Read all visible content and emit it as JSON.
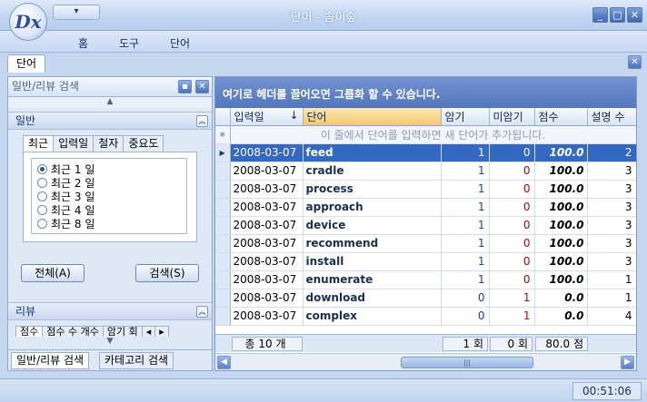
{
  "window": {
    "title": "단어 - 솜이숲",
    "logo_text": "Dx",
    "qat_glyph": "▾",
    "min_glyph": "_",
    "max_glyph": "□",
    "close_glyph": "✕"
  },
  "menu": [
    "홈",
    "도구",
    "단어"
  ],
  "doc_tab": {
    "label": "단어",
    "close_glyph": "✕"
  },
  "left_panel": {
    "title": "일반/리뷰 검색",
    "general": {
      "header": "일반",
      "tabs": [
        "최근",
        "입력일",
        "철자",
        "중요도"
      ],
      "active_tab": 0,
      "radios": [
        {
          "label": "최근 1 일",
          "checked": true
        },
        {
          "label": "최근 2 일",
          "checked": false
        },
        {
          "label": "최근 3 일",
          "checked": false
        },
        {
          "label": "최근 4 일",
          "checked": false
        },
        {
          "label": "최근 8 일",
          "checked": false
        }
      ],
      "all_button": "전체(A)",
      "search_button": "검색(S)"
    },
    "review": {
      "header": "리뷰",
      "tabs": [
        "점수",
        "점수 수 개수",
        "암기 회"
      ]
    },
    "bottom_tabs": [
      "일반/리뷰 검색",
      "카테고리 검색"
    ]
  },
  "grid": {
    "group_hint": "여기로 헤더를 끌어오면 그룹화 할 수 있습니다.",
    "columns": [
      "입력일",
      "단어",
      "암기",
      "미암기",
      "점수",
      "설명 수"
    ],
    "sort_glyph": "↓",
    "new_row_hint": "이 줄에서 단어를 입력하면 새 단어가 추가됩니다.",
    "new_row_glyph": "✱",
    "current_row_glyph": "▶",
    "rows": [
      {
        "date": "2008-03-07",
        "word": "feed",
        "memorized": "1",
        "unmemorized": "0",
        "score": "100.0",
        "desc": "2"
      },
      {
        "date": "2008-03-07",
        "word": "cradle",
        "memorized": "1",
        "unmemorized": "0",
        "score": "100.0",
        "desc": "3"
      },
      {
        "date": "2008-03-07",
        "word": "process",
        "memorized": "1",
        "unmemorized": "0",
        "score": "100.0",
        "desc": "3"
      },
      {
        "date": "2008-03-07",
        "word": "approach",
        "memorized": "1",
        "unmemorized": "0",
        "score": "100.0",
        "desc": "3"
      },
      {
        "date": "2008-03-07",
        "word": "device",
        "memorized": "1",
        "unmemorized": "0",
        "score": "100.0",
        "desc": "3"
      },
      {
        "date": "2008-03-07",
        "word": "recommend",
        "memorized": "1",
        "unmemorized": "0",
        "score": "100.0",
        "desc": "3"
      },
      {
        "date": "2008-03-07",
        "word": "install",
        "memorized": "1",
        "unmemorized": "0",
        "score": "100.0",
        "desc": "3"
      },
      {
        "date": "2008-03-07",
        "word": "enumerate",
        "memorized": "1",
        "unmemorized": "0",
        "score": "100.0",
        "desc": "1"
      },
      {
        "date": "2008-03-07",
        "word": "download",
        "memorized": "0",
        "unmemorized": "1",
        "score": "0.0",
        "desc": "1"
      },
      {
        "date": "2008-03-07",
        "word": "complex",
        "memorized": "0",
        "unmemorized": "1",
        "score": "0.0",
        "desc": "4"
      }
    ],
    "selected_row": 0,
    "footer": {
      "total": "총 10 개",
      "memorized": "1 회",
      "unmemorized": "0 회",
      "score": "80.0 점"
    },
    "scroll_thumb_glyph": "|||"
  },
  "status": {
    "clock": "00:51:06"
  }
}
